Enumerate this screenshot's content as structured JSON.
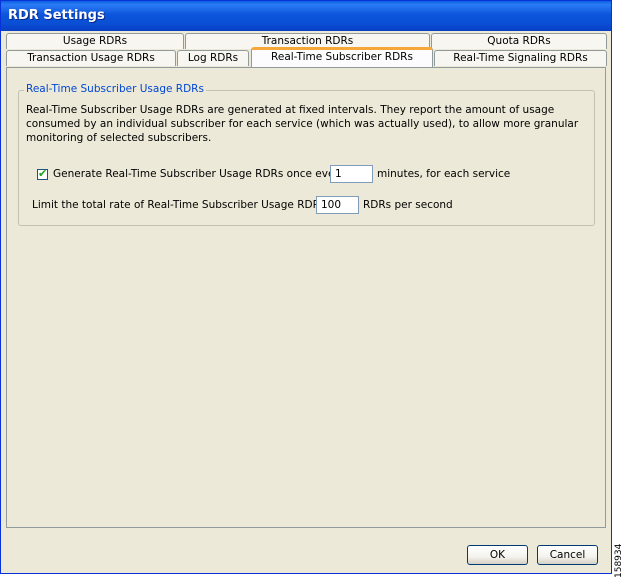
{
  "window": {
    "title": "RDR Settings"
  },
  "tabs": {
    "row_back": [
      "Usage RDRs",
      "Transaction RDRs",
      "Quota RDRs"
    ],
    "row_front": [
      "Transaction Usage RDRs",
      "Log RDRs",
      "Real-Time Subscriber RDRs",
      "Real-Time Signaling RDRs"
    ],
    "active": "Real-Time Subscriber RDRs"
  },
  "group": {
    "title": "Real-Time Subscriber Usage RDRs",
    "description": "Real-Time Subscriber Usage RDRs are generated at fixed intervals. They report the amount of usage consumed by an individual subscriber for each service (which was actually used), to allow more granular monitoring of selected subscribers.",
    "generate_checkbox": {
      "checked": true,
      "label": "Generate Real-Time Subscriber Usage RDRs once every"
    },
    "interval_value": "1",
    "interval_suffix": "minutes, for each service",
    "limit_label": "Limit the total rate of Real-Time Subscriber Usage RDRs to",
    "limit_value": "100",
    "limit_suffix": "RDRs per second"
  },
  "buttons": {
    "ok_label": "OK",
    "cancel_label": "Cancel"
  },
  "side_number": "158934"
}
